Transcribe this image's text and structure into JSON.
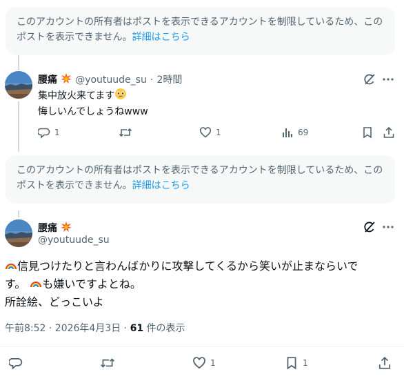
{
  "notice": {
    "text": "このアカウントの所有者はポストを表示できるアカウントを制限しているため、このポストを表示できません。",
    "link": "詳細はこちら"
  },
  "reply": {
    "name": "腰痛",
    "handle": "@youtuude_su",
    "time": "2時間",
    "line1": "集中放火来てます",
    "line2": "悔しいんでしょうねwww",
    "replies": "1",
    "likes": "1",
    "views": "69"
  },
  "main": {
    "name": "腰痛",
    "handle": "@youtuude_su",
    "text_line1": "信見つけたりと言わんばかりに攻撃してくるから笑いが止まならいで",
    "text_line2a": "す。",
    "text_line2b": "も嫌いですよとね。",
    "text_line3": "所詮絵、どっこいよ",
    "timestamp": "午前8:52 · 2026年4月3日 · ",
    "views_count": "61",
    "views_label": " 件の表示",
    "likes": "1",
    "bookmarks": "1"
  },
  "icons": [
    "grok-icon",
    "more-icon",
    "reply-icon",
    "retweet-icon",
    "like-icon",
    "views-icon",
    "bookmark-icon",
    "share-icon",
    "collision-emoji",
    "rainbow-emoji",
    "pleading-emoji"
  ],
  "colors": {
    "link": "#1d9bf0",
    "muted": "#536471",
    "notice_bg": "#f7f9f9"
  }
}
